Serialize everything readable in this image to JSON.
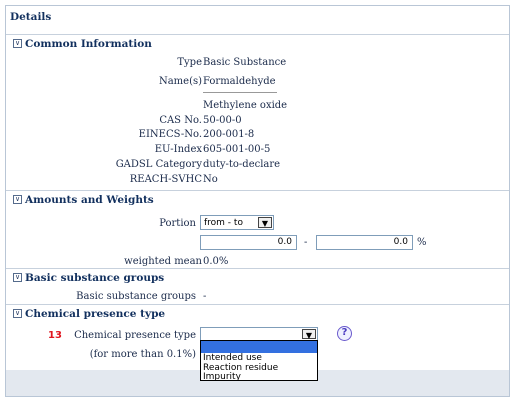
{
  "details": {
    "title": "Details"
  },
  "common": {
    "header": "Common Information",
    "type_label": "Type",
    "type_value": "Basic Substance",
    "names_label": "Name(s)",
    "names": [
      "Formaldehyde",
      "Methylene oxide"
    ],
    "cas_label": "CAS No.",
    "cas_value": "50-00-0",
    "einecs_label": "EINECS-No.",
    "einecs_value": "200-001-8",
    "euindex_label": "EU-Index",
    "euindex_value": "605-001-00-5",
    "gadsl_label": "GADSL Category",
    "gadsl_value": "duty-to-declare",
    "reach_label": "REACH-SVHC",
    "reach_value": "No"
  },
  "amounts": {
    "header": "Amounts and Weights",
    "portion_label": "Portion",
    "portion_selected": "from - to",
    "from_value": "0.0",
    "dash": "-",
    "to_value": "0.0",
    "unit": "%",
    "weighted_label": "weighted mean",
    "weighted_value": "0.0%"
  },
  "basic_groups": {
    "header": "Basic substance groups",
    "label": "Basic substance groups",
    "value": "-"
  },
  "chemical": {
    "header": "Chemical presence type",
    "step_number": "13",
    "label": "Chemical presence type",
    "note": "(for more than 0.1%)",
    "selected": "",
    "options": [
      "Intended use",
      "Reaction residue",
      "Impurity"
    ],
    "help_glyph": "?"
  }
}
